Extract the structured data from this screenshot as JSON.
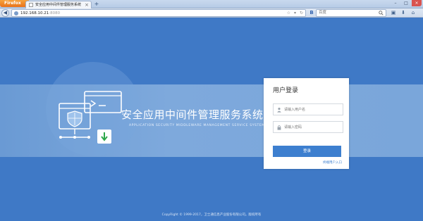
{
  "browser": {
    "app_button": "Firefox",
    "tab_title": "安全应用中间件管理服务系统",
    "tab_close": "×",
    "new_tab": "+",
    "url_host": "192.168.10.21",
    "url_port": ":8080",
    "search_placeholder": "百度",
    "window_buttons": [
      "–",
      "□",
      "×"
    ]
  },
  "page": {
    "system_title": "安全应用中间件管理服务系统",
    "system_subtitle": "APPLICATION SECURITY MIDDLEWARE MANAGEMENT SERVICE SYSTEM",
    "login": {
      "title": "用户登录",
      "username_placeholder": "请输入用户名",
      "password_placeholder": "请输入密码",
      "submit_label": "登录",
      "terminal_link": "终端用户入口"
    },
    "copyright": "CopyRight © 1999-2017，卫士通信息产业股份有限公司。版权所有"
  },
  "colors": {
    "page_background": "#3f79c6",
    "band": "#7aa6da",
    "accent": "#3d7fcf"
  },
  "icons": [
    "firefox-logo",
    "page-favicon",
    "globe-icon",
    "star-icon",
    "reload-icon",
    "baidu-icon",
    "search-icon",
    "home-icon",
    "user-icon",
    "lock-icon",
    "shield-icon",
    "terminal-icon",
    "download-icon"
  ]
}
